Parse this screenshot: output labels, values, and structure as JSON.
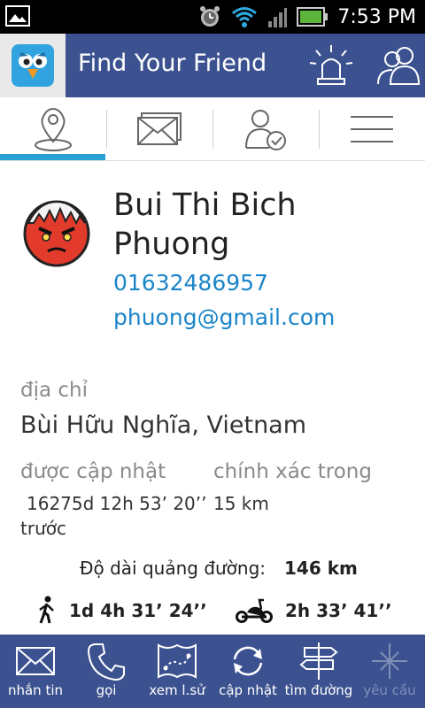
{
  "status_bar": {
    "time": "7:53 PM"
  },
  "app_bar": {
    "title": "Find Your Friend",
    "background": "#3c5290"
  },
  "tabs": [
    {
      "icon": "location-pin-icon",
      "selected": true
    },
    {
      "icon": "envelope-icon",
      "selected": false
    },
    {
      "icon": "contact-check-icon",
      "selected": false
    },
    {
      "icon": "menu-icon",
      "selected": false
    }
  ],
  "contact": {
    "name": "Bui Thi Bich Phuong",
    "phone": "01632486957",
    "email": "phuong@gmail.com"
  },
  "location": {
    "address_label": "địa chỉ",
    "address": "Bùi Hữu Nghĩa, Vietnam",
    "updated_label": "được cập nhật",
    "updated_value": "16275d 12h 53’ 20’’",
    "updated_suffix": "trước",
    "accuracy_label": "chính xác trong",
    "accuracy_value": "15 km"
  },
  "route": {
    "distance_label": "Độ dài quảng đường:",
    "distance_value": "146 km",
    "walk_time": "1d 4h 31’ 24’’",
    "bike_time": "2h 33’ 41’’"
  },
  "bottom_bar": [
    {
      "label": "nhắn tin",
      "icon": "envelope-icon",
      "enabled": true
    },
    {
      "label": "gọi",
      "icon": "phone-icon",
      "enabled": true
    },
    {
      "label": "xem l.sử",
      "icon": "map-icon",
      "enabled": true
    },
    {
      "label": "cập nhật",
      "icon": "refresh-icon",
      "enabled": true
    },
    {
      "label": "tìm đường",
      "icon": "signpost-icon",
      "enabled": true
    },
    {
      "label": "yêu cầu",
      "icon": "request-icon",
      "enabled": false
    }
  ],
  "colors": {
    "accent": "#2aa0d4",
    "link": "#1a85c9",
    "bar": "#3c5290"
  }
}
